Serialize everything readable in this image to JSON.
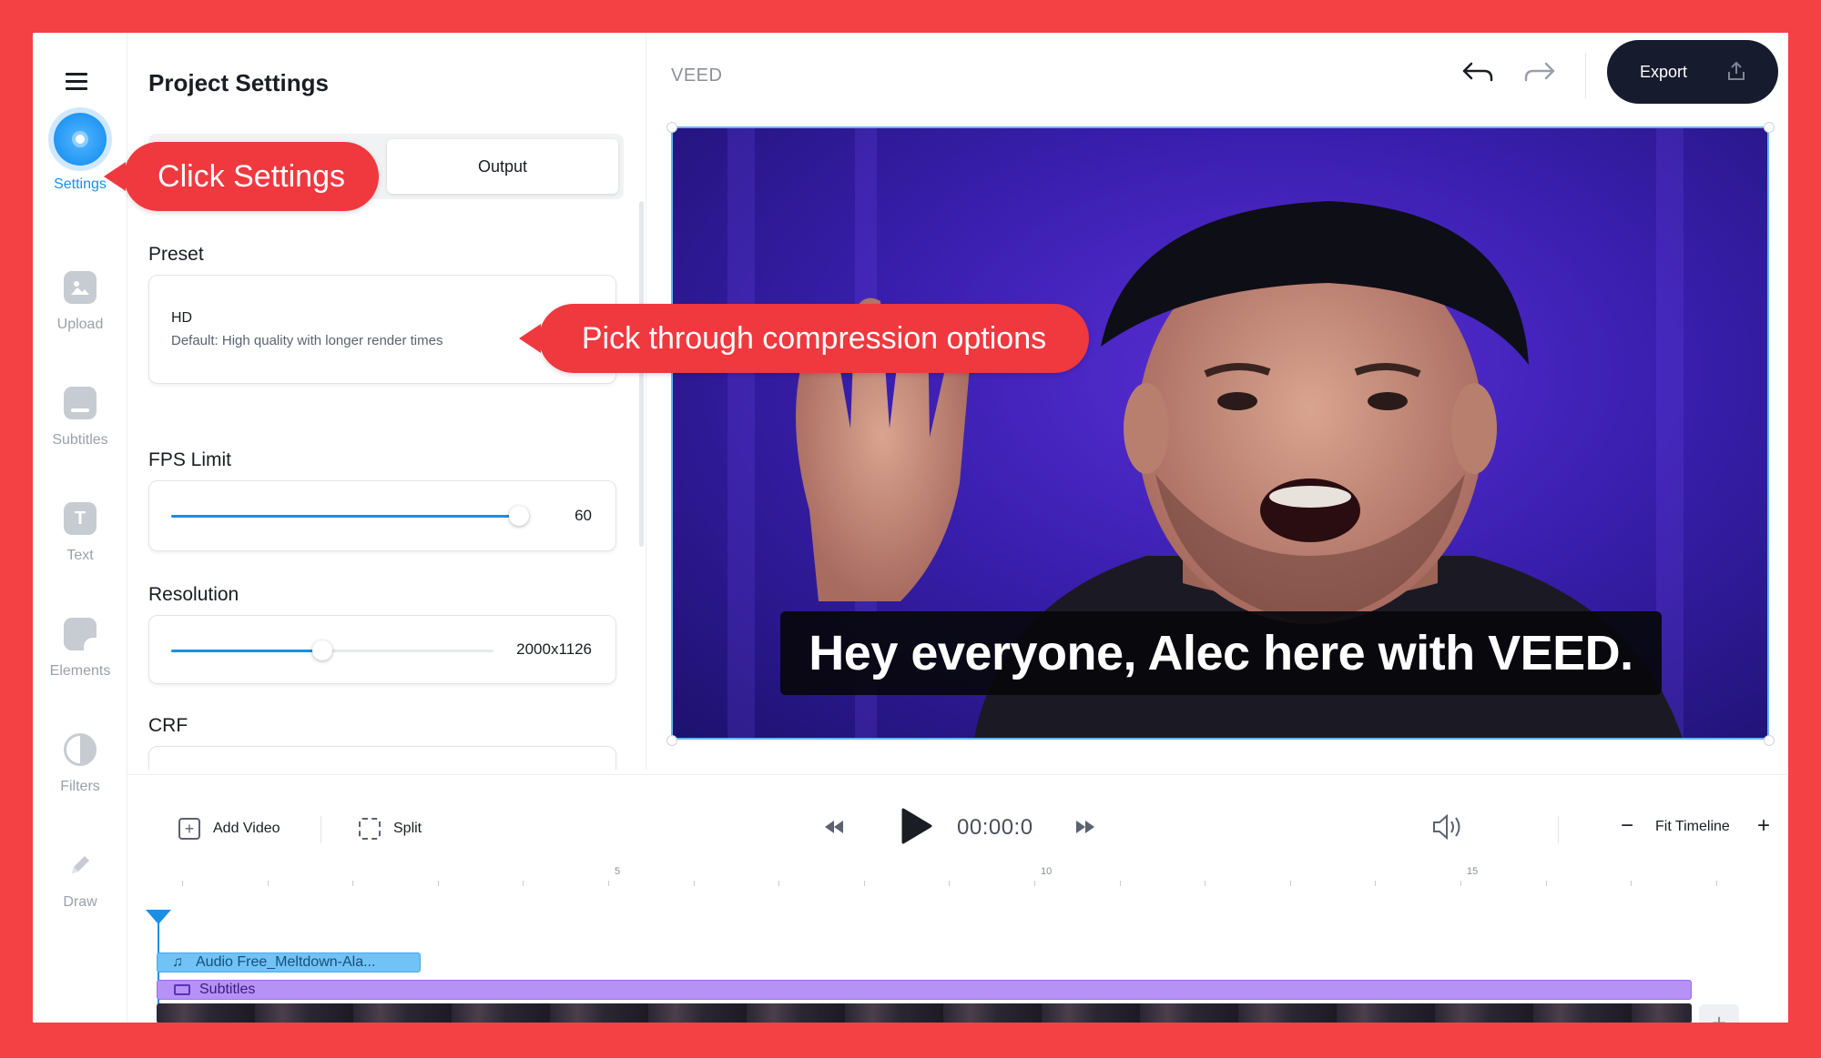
{
  "nav": {
    "items": [
      {
        "label": "Settings",
        "icon": "settings-icon"
      },
      {
        "label": "Upload",
        "icon": "image-icon"
      },
      {
        "label": "Subtitles",
        "icon": "subtitles-icon"
      },
      {
        "label": "Text",
        "icon": "text-icon",
        "glyph": "T"
      },
      {
        "label": "Elements",
        "icon": "elements-icon"
      },
      {
        "label": "Filters",
        "icon": "filters-icon"
      },
      {
        "label": "Draw",
        "icon": "pencil-icon"
      }
    ]
  },
  "panel": {
    "title": "Project Settings",
    "tabs": {
      "output_label": "Output"
    },
    "preset": {
      "label": "Preset",
      "name": "HD",
      "description": "Default: High quality with longer render times"
    },
    "fps": {
      "label": "FPS Limit",
      "value": "60",
      "fill_fraction": 0.98
    },
    "resolution": {
      "label": "Resolution",
      "value": "2000x1126",
      "fill_fraction": 0.47
    },
    "crf": {
      "label": "CRF"
    }
  },
  "topbar": {
    "brand": "VEED",
    "export_label": "Export"
  },
  "video": {
    "caption": "Hey everyone, Alec here with VEED."
  },
  "callouts": {
    "settings": "Click Settings",
    "compression": "Pick through compression options"
  },
  "timeline": {
    "add_video_label": "Add Video",
    "split_label": "Split",
    "time": "00:00:0",
    "fit_label": "Fit Timeline",
    "ruler_labels": [
      "5",
      "10",
      "15"
    ],
    "tracks": {
      "audio": "Audio Free_Meltdown-Ala...",
      "subtitles": "Subtitles"
    }
  },
  "colors": {
    "frame": "#f44144",
    "accent": "#1a8fe3",
    "export_bg": "#161c2d",
    "callout": "#f0383f"
  }
}
